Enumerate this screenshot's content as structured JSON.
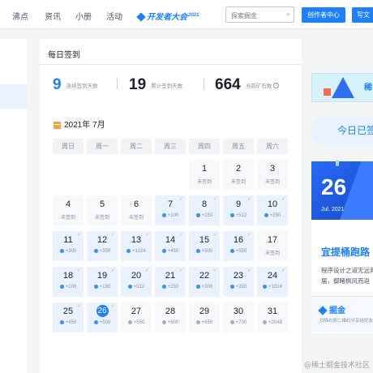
{
  "nav": {
    "items": [
      "沸点",
      "资讯",
      "小册",
      "活动"
    ],
    "dev_event": "开发者大会",
    "dev_event_year": "2021",
    "search_placeholder": "探索掘金",
    "creator_label": "创作者中心",
    "write_label": "写文"
  },
  "signin": {
    "title": "每日签到",
    "stats": [
      {
        "value": "9",
        "label": "连续签到天数"
      },
      {
        "value": "19",
        "label": "累计签到天数"
      },
      {
        "value": "664",
        "label": "当前矿石数"
      }
    ],
    "month": "2021年 7月",
    "weekdays": [
      "周日",
      "周一",
      "周二",
      "周三",
      "周四",
      "周五",
      "周六"
    ],
    "today": 26,
    "days": [
      {
        "d": "1",
        "s": "未签到",
        "signed": false
      },
      {
        "d": "2",
        "s": "未签到",
        "signed": false
      },
      {
        "d": "3",
        "s": "未签到",
        "signed": false
      },
      {
        "d": "4",
        "s": "未签到",
        "signed": false
      },
      {
        "d": "5",
        "s": "未签到",
        "signed": false
      },
      {
        "d": "6",
        "s": "未签到",
        "signed": false
      },
      {
        "d": "7",
        "s": "+100",
        "signed": true
      },
      {
        "d": "8",
        "s": "+150",
        "signed": true
      },
      {
        "d": "9",
        "s": "+512",
        "signed": true
      },
      {
        "d": "10",
        "s": "+250",
        "signed": true
      },
      {
        "d": "11",
        "s": "+300",
        "signed": true
      },
      {
        "d": "12",
        "s": "+350",
        "signed": true
      },
      {
        "d": "13",
        "s": "+1024",
        "signed": true
      },
      {
        "d": "14",
        "s": "+450",
        "signed": true
      },
      {
        "d": "15",
        "s": "+500",
        "signed": true
      },
      {
        "d": "16",
        "s": "+550",
        "signed": true
      },
      {
        "d": "17",
        "s": "未签到",
        "signed": false
      },
      {
        "d": "18",
        "s": "+100",
        "signed": true
      },
      {
        "d": "19",
        "s": "+150",
        "signed": true
      },
      {
        "d": "20",
        "s": "+512",
        "signed": true
      },
      {
        "d": "21",
        "s": "+250",
        "signed": true
      },
      {
        "d": "22",
        "s": "+300",
        "signed": true
      },
      {
        "d": "23",
        "s": "+350",
        "signed": true
      },
      {
        "d": "24",
        "s": "+1024",
        "signed": true
      },
      {
        "d": "25",
        "s": "+450",
        "signed": true
      },
      {
        "d": "26",
        "s": "+500",
        "signed": true
      },
      {
        "d": "27",
        "s": "+550",
        "signed": false
      },
      {
        "d": "28",
        "s": "+600",
        "signed": false
      },
      {
        "d": "29",
        "s": "+650",
        "signed": false
      },
      {
        "d": "30",
        "s": "+700",
        "signed": false
      },
      {
        "d": "31",
        "s": "+2048",
        "signed": false
      }
    ]
  },
  "right": {
    "banner_text": "稀",
    "signed_today": "今日已签",
    "promo_day": "26",
    "promo_month": "Jul. 2021",
    "promo_title": "宜提桶跑路",
    "promo_desc": "程序设计之道无远弗届，御睹枫风而返",
    "brand": "掘金",
    "footer_text": "扫描右侧二维码分享给好友"
  },
  "watermark": "@稀土掘金技术社区"
}
